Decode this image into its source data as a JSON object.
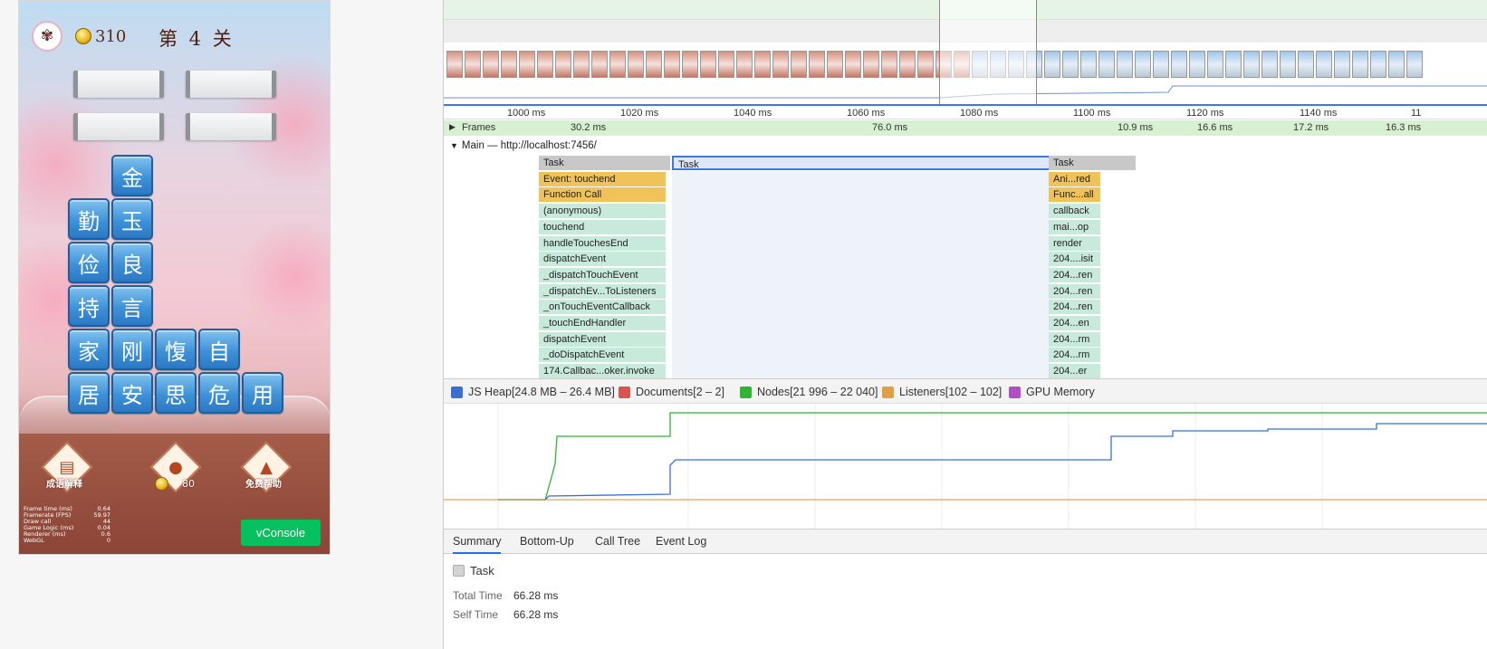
{
  "game": {
    "logo_glyph": "✾",
    "coins": "310",
    "level": "第 4 关",
    "tiles": [
      {
        "char": "金",
        "col": 1,
        "row": 0
      },
      {
        "char": "勤",
        "col": 0,
        "row": 1
      },
      {
        "char": "玉",
        "col": 1,
        "row": 1
      },
      {
        "char": "俭",
        "col": 0,
        "row": 2
      },
      {
        "char": "良",
        "col": 1,
        "row": 2
      },
      {
        "char": "持",
        "col": 0,
        "row": 3
      },
      {
        "char": "言",
        "col": 1,
        "row": 3
      },
      {
        "char": "家",
        "col": 0,
        "row": 4
      },
      {
        "char": "刚",
        "col": 1,
        "row": 4
      },
      {
        "char": "愎",
        "col": 2,
        "row": 4
      },
      {
        "char": "自",
        "col": 3,
        "row": 4
      },
      {
        "char": "居",
        "col": 0,
        "row": 5
      },
      {
        "char": "安",
        "col": 1,
        "row": 5
      },
      {
        "char": "思",
        "col": 2,
        "row": 5
      },
      {
        "char": "危",
        "col": 3,
        "row": 5
      },
      {
        "char": "用",
        "col": 4,
        "row": 5
      }
    ],
    "tools": {
      "explain_label": "成语解释",
      "hint_cost": "80",
      "help_label": "免费帮助"
    },
    "stats": [
      {
        "label": "Frame time (ms)",
        "value": "0.64"
      },
      {
        "label": "Framerate (FPS)",
        "value": "59.97"
      },
      {
        "label": "Draw call",
        "value": "44"
      },
      {
        "label": "Game Logic (ms)",
        "value": "0.04"
      },
      {
        "label": "Renderer (ms)",
        "value": "0.6"
      },
      {
        "label": "WebGL",
        "value": "0"
      }
    ],
    "vconsole_label": "vConsole"
  },
  "devtools": {
    "ruler_ticks": [
      "1000 ms",
      "1020 ms",
      "1040 ms",
      "1060 ms",
      "1080 ms",
      "1100 ms",
      "1120 ms",
      "1140 ms",
      "11"
    ],
    "frames_label": "Frames",
    "frame_times": [
      "30.2 ms",
      "76.0 ms",
      "10.9 ms",
      "16.6 ms",
      "17.2 ms",
      "16.3 ms"
    ],
    "main_label": "Main — http://localhost:7456/",
    "flame_left": [
      "Task",
      "Event: touchend",
      "Function Call",
      "(anonymous)",
      "touchend",
      "handleTouchesEnd",
      "dispatchEvent",
      "_dispatchTouchEvent",
      "_dispatchEv...ToListeners",
      "_onTouchEventCallback",
      "_touchEndHandler",
      "dispatchEvent",
      "_doDispatchEvent",
      "174.Callbac...oker.invoke"
    ],
    "flame_mid": "Task",
    "flame_right": [
      "Task",
      "Ani...red",
      "Func...all",
      "callback",
      "mai...op",
      "render",
      "204....isit",
      "204...ren",
      "204...ren",
      "204...ren",
      "204...en",
      "204...rm",
      "204...rm",
      "204...er"
    ],
    "memory_items": [
      {
        "label": "JS Heap[24.8 MB – 26.4 MB]",
        "color": "#3b6fd4"
      },
      {
        "label": "Documents[2 – 2]",
        "color": "#d9534f"
      },
      {
        "label": "Nodes[21 996 – 22 040]",
        "color": "#2fb52f"
      },
      {
        "label": "Listeners[102 – 102]",
        "color": "#e0a042"
      },
      {
        "label": "GPU Memory",
        "color": "#b04fc4"
      }
    ],
    "tabs": [
      "Summary",
      "Bottom-Up",
      "Call Tree",
      "Event Log"
    ],
    "active_tab": "Summary",
    "summary": {
      "title": "Task",
      "total_time_label": "Total Time",
      "total_time": "66.28 ms",
      "self_time_label": "Self Time",
      "self_time": "66.28 ms"
    }
  }
}
